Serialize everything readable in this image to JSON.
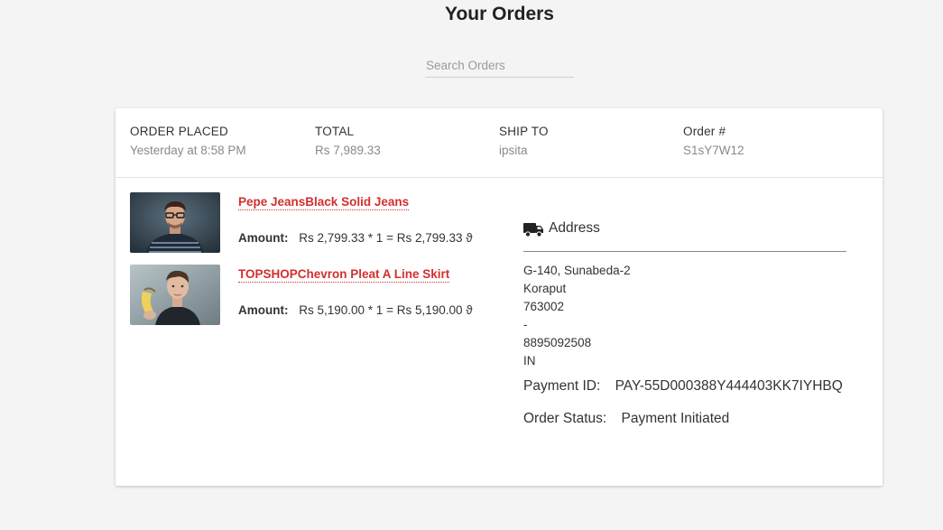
{
  "page": {
    "title": "Your Orders"
  },
  "search": {
    "placeholder": "Search Orders",
    "value": ""
  },
  "order": {
    "header": [
      {
        "label": "ORDER PLACED",
        "value": "Yesterday at 8:58 PM"
      },
      {
        "label": "TOTAL",
        "value": "Rs 7,989.33"
      },
      {
        "label": "SHIP TO",
        "value": "ipsita"
      },
      {
        "label": "Order #",
        "value": "S1sY7W12"
      }
    ],
    "items": [
      {
        "title": "Pepe JeansBlack Solid Jeans",
        "amount_label": "Amount:",
        "amount": "Rs 2,799.33 * 1 = Rs 2,799.33 ϑ"
      },
      {
        "title": "TOPSHOPChevron Pleat A Line Skirt",
        "amount_label": "Amount:",
        "amount": "Rs 5,190.00 * 1 = Rs 5,190.00 ϑ"
      }
    ],
    "address": {
      "title": "Address",
      "icon": "truck-icon",
      "lines": [
        "G-140, Sunabeda-2",
        "Koraput",
        "763002",
        "-",
        "8895092508",
        "IN"
      ]
    },
    "payment": {
      "label": "Payment ID:",
      "value": "PAY-55D000388Y444403KK7IYHBQ"
    },
    "status": {
      "label": "Order Status:",
      "value": "Payment Initiated"
    }
  },
  "colors": {
    "link": "#d32f2f",
    "background": "#f4f4f4",
    "card": "#ffffff"
  }
}
